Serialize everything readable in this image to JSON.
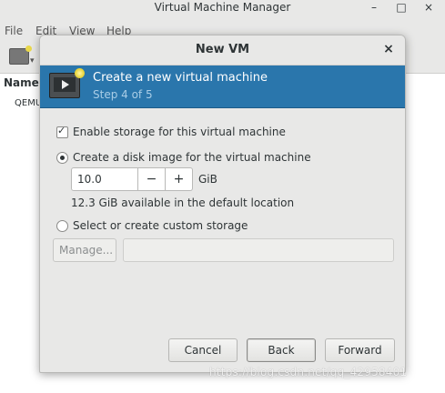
{
  "app": {
    "title": "Virtual Machine Manager",
    "window_buttons": {
      "minimize": "–",
      "maximize": "□",
      "close": "×"
    },
    "menu": [
      "File",
      "Edit",
      "View",
      "Help"
    ],
    "list_header": "Name",
    "list_row": "QEMU"
  },
  "dialog": {
    "title": "New VM",
    "close": "×",
    "banner": {
      "title": "Create a new virtual machine",
      "step": "Step 4 of 5"
    },
    "enable_storage": {
      "label": "Enable storage for this virtual machine",
      "checked": true
    },
    "create_disk": {
      "label": "Create a disk image for the virtual machine",
      "selected": true
    },
    "disk_size": {
      "value": "10.0",
      "minus": "−",
      "plus": "+",
      "unit": "GiB"
    },
    "available": "12.3 GiB available in the default location",
    "custom_storage": {
      "label": "Select or create custom storage",
      "selected": false
    },
    "manage_button": "Manage...",
    "path_value": "",
    "buttons": {
      "cancel": "Cancel",
      "back": "Back",
      "forward": "Forward"
    }
  },
  "watermark": "https://blog.csdn.net/qq_42958401",
  "colors": {
    "banner": "#2a76ac",
    "banner_step": "#a9cde6",
    "background": "#e8e8e7"
  }
}
